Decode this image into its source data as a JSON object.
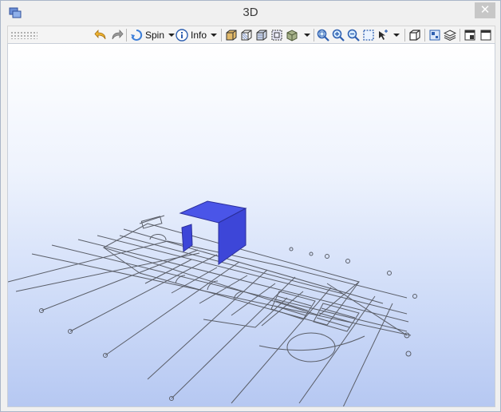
{
  "window": {
    "title": "3D"
  },
  "titlebar": {
    "close_glyph": "✕"
  },
  "toolbar": {
    "spin_label": "Spin",
    "info_label": "Info"
  },
  "colors": {
    "wall_fill": "#3d46d8",
    "wall_fill_light": "#4a55e8",
    "linework": "#5a5e68",
    "close_bg": "#c7c7c7"
  },
  "icons": [
    "undo-icon",
    "redo-icon",
    "spin-icon",
    "info-icon",
    "shaded-view-icon",
    "wireframe-view-icon",
    "hidden-line-view-icon",
    "outline-view-icon",
    "render-view-icon",
    "zoom-extents-icon",
    "zoom-in-icon",
    "zoom-out-icon",
    "zoom-window-icon",
    "pan-tool-icon",
    "view-cube-icon",
    "layers-icon",
    "stack-icon",
    "restore-window-icon",
    "maximize-window-icon"
  ]
}
